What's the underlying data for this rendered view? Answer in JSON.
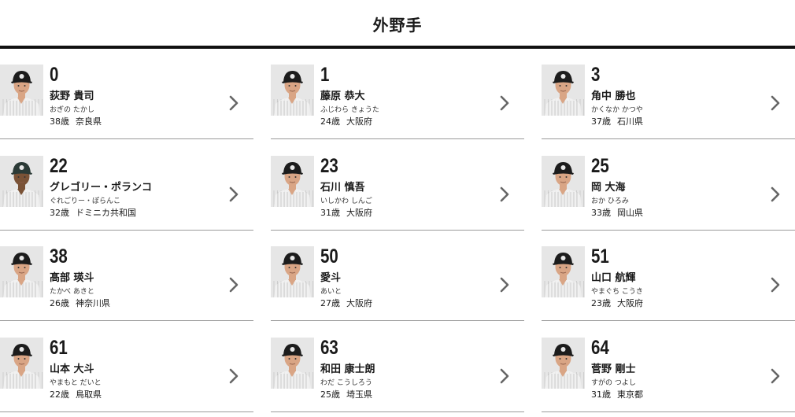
{
  "section": {
    "title": "外野手"
  },
  "players": [
    {
      "number": "0",
      "name": "荻野 貴司",
      "kana": "おぎの たかし",
      "age": "38歳",
      "birthplace": "奈良県",
      "variant": "white"
    },
    {
      "number": "1",
      "name": "藤原 恭大",
      "kana": "ふじわら きょうた",
      "age": "24歳",
      "birthplace": "大阪府",
      "variant": "white"
    },
    {
      "number": "3",
      "name": "角中 勝也",
      "kana": "かくなか かつや",
      "age": "37歳",
      "birthplace": "石川県",
      "variant": "white"
    },
    {
      "number": "22",
      "name": "グレゴリー・ポランコ",
      "kana": "ぐれごりー・ぽらんこ",
      "age": "32歳",
      "birthplace": "ドミニカ共和国",
      "variant": "dark"
    },
    {
      "number": "23",
      "name": "石川 慎吾",
      "kana": "いしかわ しんご",
      "age": "31歳",
      "birthplace": "大阪府",
      "variant": "white"
    },
    {
      "number": "25",
      "name": "岡 大海",
      "kana": "おか ひろみ",
      "age": "33歳",
      "birthplace": "岡山県",
      "variant": "white"
    },
    {
      "number": "38",
      "name": "髙部 瑛斗",
      "kana": "たかべ あきと",
      "age": "26歳",
      "birthplace": "神奈川県",
      "variant": "white"
    },
    {
      "number": "50",
      "name": "愛斗",
      "kana": "あいと",
      "age": "27歳",
      "birthplace": "大阪府",
      "variant": "white"
    },
    {
      "number": "51",
      "name": "山口 航輝",
      "kana": "やまぐち こうき",
      "age": "23歳",
      "birthplace": "大阪府",
      "variant": "white"
    },
    {
      "number": "61",
      "name": "山本 大斗",
      "kana": "やまもと だいと",
      "age": "22歳",
      "birthplace": "鳥取県",
      "variant": "white"
    },
    {
      "number": "63",
      "name": "和田 康士朗",
      "kana": "わだ こうしろう",
      "age": "25歳",
      "birthplace": "埼玉県",
      "variant": "white"
    },
    {
      "number": "64",
      "name": "菅野 剛士",
      "kana": "すがの つよし",
      "age": "31歳",
      "birthplace": "東京都",
      "variant": "white"
    }
  ],
  "icons": {
    "player_photo": "player-photo",
    "arrow": "chevron-right-icon"
  },
  "colors": {
    "rule": "#111111",
    "divider": "#9a9a9a",
    "chevron": "#666666",
    "cap": "#1c1c1c"
  }
}
